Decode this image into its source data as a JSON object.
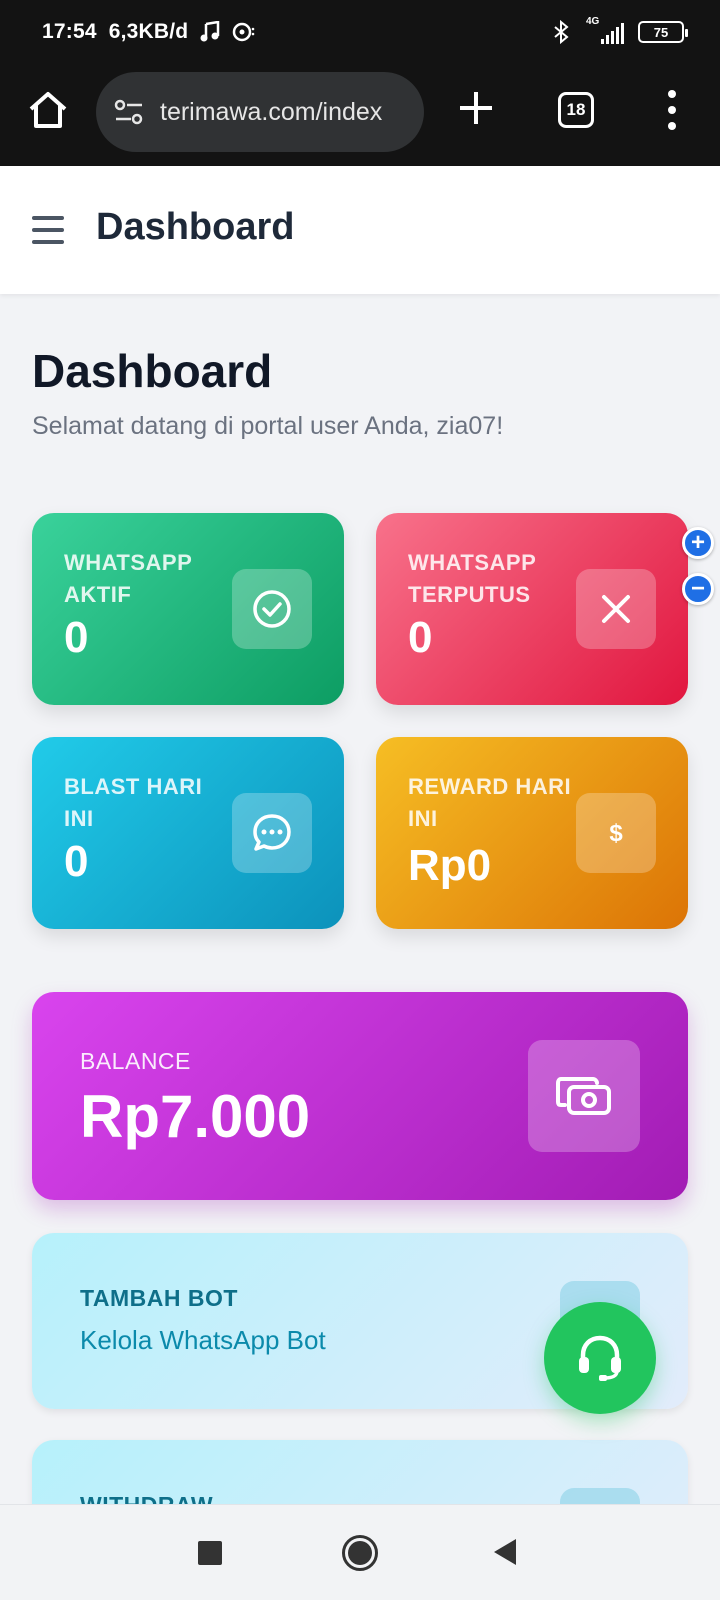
{
  "status_bar": {
    "time": "17:54",
    "network_speed": "6,3KB/d",
    "icons": [
      "music-note-icon",
      "media-icon",
      "bluetooth-icon",
      "signal-4g-icon"
    ],
    "network_type": "4G",
    "battery": "75"
  },
  "browser": {
    "url": "terimawa.com/index",
    "tab_count": "18",
    "icons": [
      "home-icon",
      "site-settings-icon",
      "new-tab-icon",
      "tabs-icon",
      "more-icon"
    ]
  },
  "header": {
    "title": "Dashboard"
  },
  "page": {
    "title": "Dashboard",
    "subtitle": "Selamat datang di portal user Anda, zia07!"
  },
  "stats": [
    {
      "label": "WHATSAPP AKTIF",
      "value": "0",
      "icon": "check-circle-icon",
      "color": "#10b981"
    },
    {
      "label": "WHATSAPP TERPUTUS",
      "value": "0",
      "icon": "x-icon",
      "color": "#f43f5e"
    },
    {
      "label": "BLAST HARI INI",
      "value": "0",
      "icon": "chat-bubble-icon",
      "color": "#06b6d4"
    },
    {
      "label": "REWARD HARI INI",
      "value": "Rp0",
      "icon": "dollar-icon",
      "color": "#f59e0b"
    }
  ],
  "zoom": {
    "in": "+",
    "out": "−"
  },
  "balance": {
    "label": "BALANCE",
    "value": "Rp7.000",
    "icon": "money-icon",
    "color": "#c026d3"
  },
  "actions": [
    {
      "title": "TAMBAH BOT",
      "subtitle": "Kelola WhatsApp Bot"
    },
    {
      "title": "WITHDRAW",
      "subtitle": ""
    }
  ],
  "fab": {
    "icon": "headset-icon",
    "color": "#22c55e"
  }
}
